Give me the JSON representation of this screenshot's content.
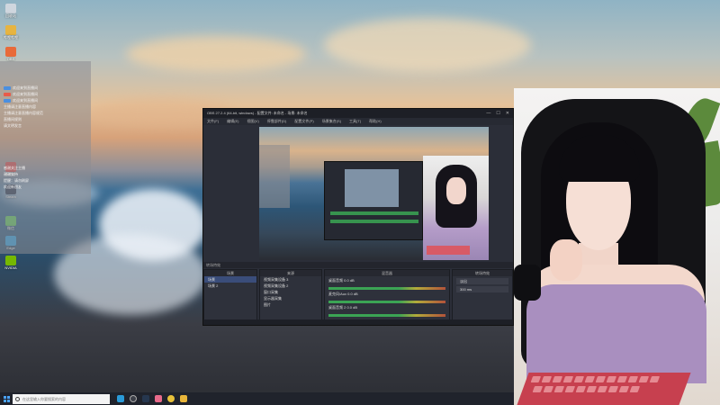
{
  "desktop": {
    "icons": [
      {
        "label": "回收站",
        "icon": "recycle-bin-icon"
      },
      {
        "label": "哔哩哔哩",
        "icon": "app-icon"
      },
      {
        "label": "OBS",
        "icon": "obs-icon"
      },
      {
        "label": "直播姬",
        "icon": "app-icon"
      },
      {
        "label": "Steam",
        "icon": "steam-icon"
      },
      {
        "label": "微信",
        "icon": "wechat-icon"
      },
      {
        "label": "Edge",
        "icon": "edge-icon"
      },
      {
        "label": "NVIDIA",
        "icon": "nvidia-icon"
      }
    ]
  },
  "chat": {
    "lines": [
      "欢迎来到直播间",
      "欢迎来到直播间",
      "欢迎来到直播间",
      "主播请注意直播内容",
      "主播请注意直播内容规范",
      "直播间规则",
      "请文明发言",
      "感谢关注主播",
      "谢谢支持",
      "提醒：请勿刷屏",
      "欢迎新朋友"
    ]
  },
  "obs": {
    "title": "OBS 27.2.4 (64-bit, windows) - 配置文件: 未命名 - 场景: 未命名",
    "menu": [
      "文件(F)",
      "编辑(E)",
      "视图(V)",
      "停靠部件(D)",
      "配置文件(P)",
      "场景集合(S)",
      "工具(T)",
      "帮助(H)"
    ],
    "window_buttons": [
      "—",
      "☐",
      "✕"
    ],
    "source_label": "麦克风/Aux",
    "scenes_header": "场景",
    "sources_header": "来源",
    "mixer_header": "混音器",
    "transitions_header": "转场特效",
    "scenes": [
      "场景",
      "场景 2"
    ],
    "sources": [
      "视频采集设备 3",
      "视频采集设备 2",
      "窗口采集",
      "显示器采集",
      "图片",
      "媒体源"
    ],
    "mixer_rows": [
      "桌面音频  0.0 dB",
      "麦克风/Aux  0.0 dB",
      "桌面音频 2  0.0 dB"
    ],
    "transition": "淡出",
    "duration": "300 ms"
  },
  "taskbar": {
    "search_placeholder": "在这里输入你要搜索的内容",
    "apps": [
      "edge-icon",
      "obs-icon",
      "steam-icon",
      "bilibili-icon",
      "chrome-icon",
      "explorer-icon"
    ]
  },
  "colors": {
    "obs_bg": "#2b2e38",
    "accent": "#4aa3ff",
    "taskbar": "#20232c"
  }
}
